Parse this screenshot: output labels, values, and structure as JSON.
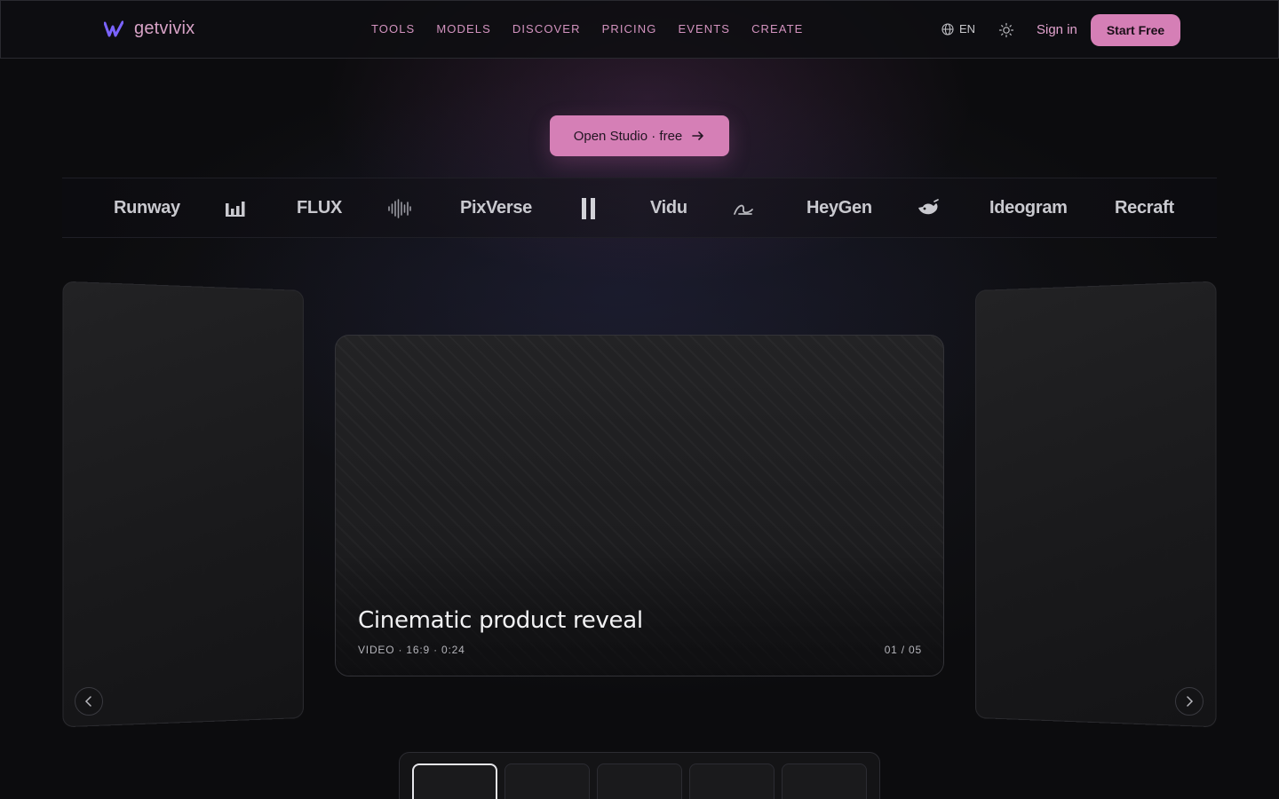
{
  "brand": {
    "name": "getvivix",
    "accent": "#d57fb6",
    "logo_color": "#7a63ff"
  },
  "nav": {
    "links": [
      {
        "label": "TOOLS"
      },
      {
        "label": "MODELS"
      },
      {
        "label": "DISCOVER"
      },
      {
        "label": "PRICING"
      },
      {
        "label": "EVENTS"
      },
      {
        "label": "CREATE"
      }
    ],
    "language": "EN",
    "language_icon": "globe-icon",
    "theme_icon": "sun-icon",
    "sign_in": "Sign in",
    "start_free": "Start Free"
  },
  "hero": {
    "cta_label": "Open Studio · free",
    "cta_icon": "arrow-right-icon"
  },
  "marquee": {
    "items": [
      {
        "type": "text",
        "label": "Runway"
      },
      {
        "type": "icon",
        "icon": "bars-logo-icon"
      },
      {
        "type": "text",
        "label": "FLUX"
      },
      {
        "type": "icon",
        "icon": "waveform-logo-icon"
      },
      {
        "type": "text",
        "label": "PixVerse"
      },
      {
        "type": "icon",
        "icon": "pause-logo-icon"
      },
      {
        "type": "text",
        "label": "Vidu"
      },
      {
        "type": "icon",
        "icon": "swoosh-logo-icon"
      },
      {
        "type": "text",
        "label": "HeyGen"
      },
      {
        "type": "icon",
        "icon": "whale-logo-icon"
      },
      {
        "type": "text",
        "label": "Ideogram"
      },
      {
        "type": "text",
        "label": "Recraft"
      }
    ]
  },
  "carousel": {
    "active": {
      "title": "Cinematic product reveal",
      "meta": "VIDEO · 16:9 · 0:24",
      "counter": "01 / 05"
    },
    "prev_icon": "chevron-left-icon",
    "next_icon": "chevron-right-icon",
    "thumbnail_count": 5,
    "active_thumbnail": 1
  }
}
